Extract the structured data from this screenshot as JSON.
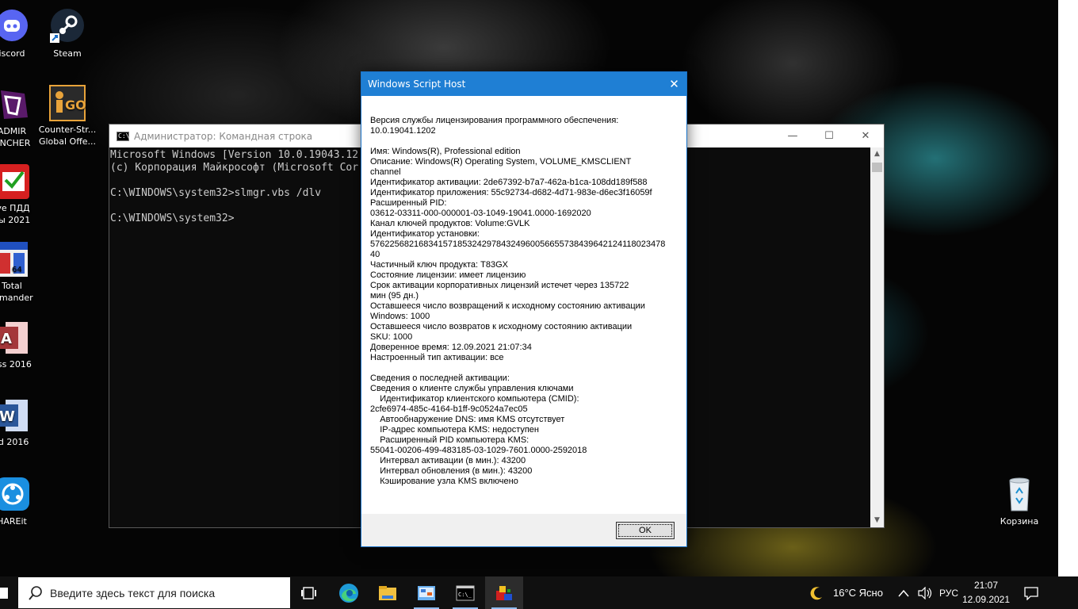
{
  "desktop": {
    "icons": [
      {
        "label": "iscord",
        "icon": "discord-icon"
      },
      {
        "label": "Steam",
        "icon": "steam-icon"
      },
      {
        "label": "ADMIR\nUNCHER",
        "icon": "launcher-icon"
      },
      {
        "label": "Counter-Str...\nGlobal Offe...",
        "icon": "csgo-icon"
      },
      {
        "label": "ive ПДД\nты 2021",
        "icon": "pdd-icon"
      },
      {
        "label": "Total\nmmander",
        "icon": "total-commander-icon"
      },
      {
        "label": "ess 2016",
        "icon": "access-icon"
      },
      {
        "label": "rd 2016",
        "icon": "word-icon"
      },
      {
        "label": "HAREit",
        "icon": "shareit-icon"
      },
      {
        "label": "Корзина",
        "icon": "recycle-bin-icon"
      }
    ]
  },
  "cmd": {
    "title": "Администратор: Командная строка",
    "lines": [
      "Microsoft Windows [Version 10.0.19043.12",
      "(c) Корпорация Майкрософт (Microsoft Cor",
      "",
      "C:\\WINDOWS\\system32>slmgr.vbs /dlv",
      "",
      "C:\\WINDOWS\\system32>"
    ]
  },
  "dialog": {
    "title": "Windows Script Host",
    "ok_label": "OK",
    "lines": [
      "Версия службы лицензирования программного обеспечения:",
      "10.0.19041.1202",
      "",
      "Имя: Windows(R), Professional edition",
      "Описание: Windows(R) Operating System, VOLUME_KMSCLIENT",
      "channel",
      "Идентификатор активации: 2de67392-b7a7-462a-b1ca-108dd189f588",
      "Идентификатор приложения: 55c92734-d682-4d71-983e-d6ec3f16059f",
      "Расширенный PID:",
      "03612-03311-000-000001-03-1049-19041.0000-1692020",
      "Канал ключей продуктов: Volume:GVLK",
      "Идентификатор установки:",
      "5762256821683415718532429784324960056655738439642124118023478",
      "40",
      "Частичный ключ продукта: T83GX",
      "Состояние лицензии: имеет лицензию",
      "Срок активации корпоративных лицензий истечет через 135722",
      "мин (95 дн.)",
      "Оставшееся число возвращений к исходному состоянию активации",
      "Windows: 1000",
      "Оставшееся число возвратов к исходному состоянию активации",
      "SKU: 1000",
      "Доверенное время: 12.09.2021 21:07:34",
      "Настроенный тип активации: все",
      "",
      "Сведения о последней активации:",
      "Сведения о клиенте службы управления ключами",
      "    Идентификатор клиентского компьютера (CMID):",
      "2cfe6974-485c-4164-b1ff-9c0524a7ec05",
      "    Автообнаружение DNS: имя KMS отсутствует",
      "    IP-адрес компьютера KMS: недоступен",
      "    Расширенный PID компьютера KMS:",
      "55041-00206-499-483185-03-1029-7601.0000-2592018",
      "    Интервал активации (в мин.): 43200",
      "    Интервал обновления (в мин.): 43200",
      "    Кэширование узла KMS включено"
    ]
  },
  "taskbar": {
    "search_placeholder": "Введите здесь текст для поиска",
    "apps": [
      "task-view-icon",
      "edge-icon",
      "file-explorer-icon",
      "control-panel-icon",
      "cmd-icon",
      "script-host-icon"
    ],
    "weather": "16°C Ясно",
    "language": "РУС",
    "time": "21:07",
    "date": "12.09.2021"
  }
}
